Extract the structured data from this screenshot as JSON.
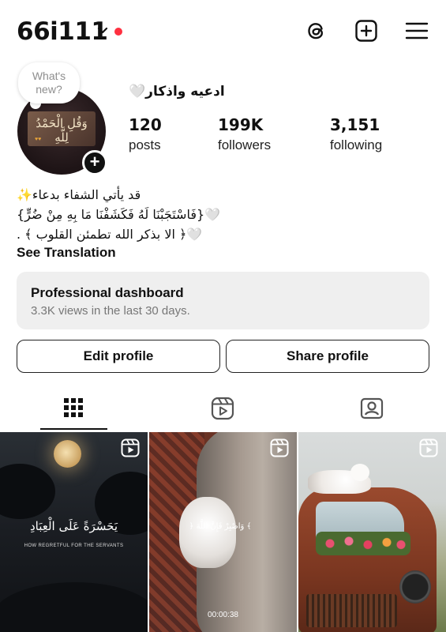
{
  "header": {
    "username": "66i111",
    "has_notification_dot": true,
    "icons": [
      "threads-icon",
      "create-post-icon",
      "menu-icon"
    ]
  },
  "profile": {
    "note_bubble": "What's new?",
    "display_name": "ادعيه واذكار🤍",
    "stats": [
      {
        "value": "120",
        "label": "posts"
      },
      {
        "value": "199K",
        "label": "followers"
      },
      {
        "value": "3,151",
        "label": "following"
      }
    ],
    "avatar_text": "وَقُلِ الْحَمْدُ لِلَّهِ"
  },
  "bio": {
    "lines": [
      "قد يأتي الشفاء بدعاء✨",
      "🤍{فَاسْتَجَبْنَا لَهُ فَكَشَفْنَا مَا بِهِ مِنْ ضُرٍّ}",
      "🤍﴿ الا بذكر الله تطمئن القلوب ﴾ ."
    ],
    "see_translation": "See Translation"
  },
  "dashboard": {
    "title": "Professional dashboard",
    "subtitle": "3.3K views in the last 30 days."
  },
  "buttons": {
    "edit_profile": "Edit profile",
    "share_profile": "Share profile"
  },
  "tabs": [
    "grid-icon",
    "reels-icon",
    "tagged-icon"
  ],
  "active_tab": "grid",
  "grid": [
    {
      "type": "reel",
      "arabic_text": "يَحَسْرَةً عَلَى الْعِبَادِ",
      "english_text": "HOW REGRETFUL FOR THE SERVANTS"
    },
    {
      "type": "reel",
      "arabic_text": "﴿ وَاصْبِرْ فَإِنَّ اللَّهَ ﴾",
      "duration": "00:00:38"
    },
    {
      "type": "reel"
    }
  ]
}
